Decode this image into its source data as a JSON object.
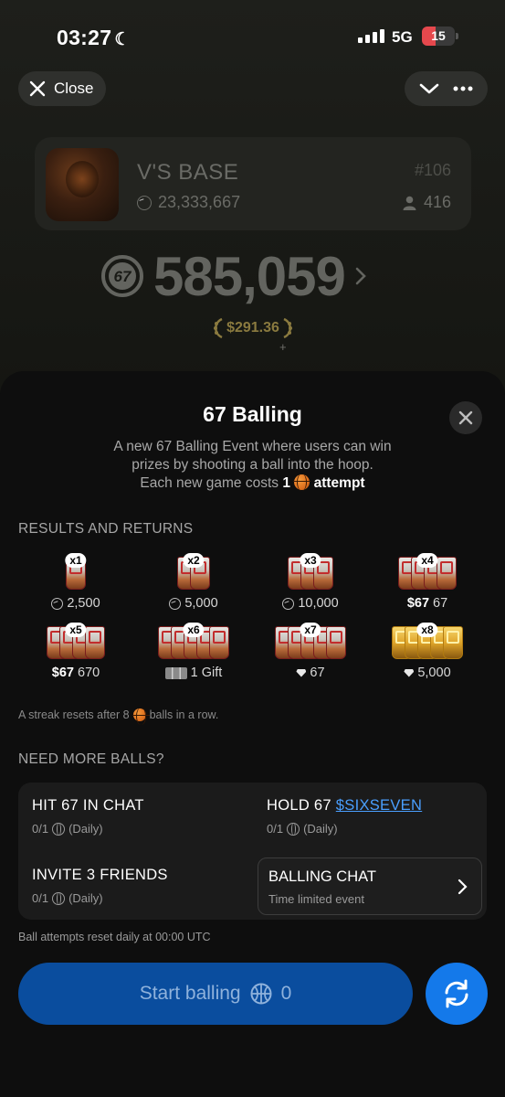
{
  "status_bar": {
    "time": "03:27",
    "network": "5G",
    "battery": "15"
  },
  "header": {
    "close_label": "Close"
  },
  "base": {
    "name": "V'S BASE",
    "coins": "23,333,667",
    "rank": "#106",
    "members": "416"
  },
  "balance": {
    "amount": "585,059",
    "usd": "$291.36",
    "plus": "+"
  },
  "sheet": {
    "title": "67 Balling",
    "desc_line1": "A new 67 Balling Event where users can win",
    "desc_line2": "prizes by shooting a ball into the hoop.",
    "desc_line3_pre": "Each new game costs",
    "desc_cost": "1",
    "desc_line3_post": "attempt"
  },
  "results": {
    "heading": "RESULTS AND RETURNS",
    "items": [
      {
        "mult": "x1",
        "reward": "2,500",
        "currency": "coin-icon",
        "hoops": 1,
        "gold": false
      },
      {
        "mult": "x2",
        "reward": "5,000",
        "currency": "coin-icon",
        "hoops": 2,
        "gold": false
      },
      {
        "mult": "x3",
        "reward": "10,000",
        "currency": "coin-icon",
        "hoops": 3,
        "gold": false
      },
      {
        "mult": "x4",
        "prefix": "$67",
        "reward": "67",
        "currency": "token",
        "hoops": 4,
        "gold": false
      },
      {
        "mult": "x5",
        "prefix": "$67",
        "reward": "670",
        "currency": "token",
        "hoops": 5,
        "gold": false
      },
      {
        "mult": "x6",
        "reward": "1 Gift",
        "currency": "gift-icon",
        "hoops": 6,
        "gold": false
      },
      {
        "mult": "x7",
        "reward": "67",
        "currency": "gem-icon",
        "hoops": 7,
        "gold": false
      },
      {
        "mult": "x8",
        "reward": "5,000",
        "currency": "gem-icon",
        "hoops": 8,
        "gold": true
      }
    ],
    "streak_pre": "A streak resets after 8",
    "streak_post": "balls in a row."
  },
  "more_balls": {
    "heading": "NEED MORE BALLS?",
    "hit_chat": {
      "title": "HIT 67 IN CHAT",
      "progress": "0/1",
      "period": "(Daily)"
    },
    "hold": {
      "title": "HOLD 67",
      "link": "$SIXSEVEN",
      "progress": "0/1",
      "period": "(Daily)"
    },
    "invite": {
      "title": "INVITE 3 FRIENDS",
      "progress": "0/1",
      "period": "(Daily)"
    },
    "chat": {
      "title": "BALLING CHAT",
      "subtitle": "Time limited event"
    }
  },
  "reset_note": "Ball attempts reset daily at 00:00 UTC",
  "start": {
    "label": "Start balling",
    "count": "0"
  },
  "colors": {
    "accent": "#1479ea",
    "start_bg": "#0a4d9e",
    "link": "#4a9fff",
    "gold": "#8a7a3f"
  }
}
